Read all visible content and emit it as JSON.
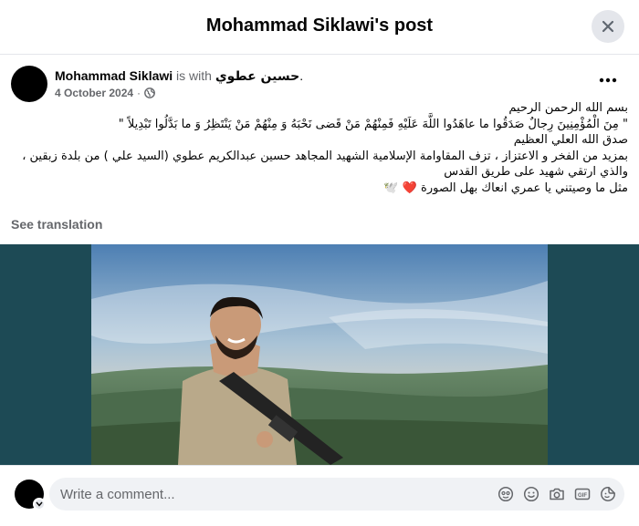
{
  "header": {
    "title": "Mohammad Siklawi's post"
  },
  "post": {
    "author": "Mohammad Siklawi",
    "is_with": "is with",
    "tagged": "حسين عطوي",
    "tagged_suffix": ".",
    "date": "4 October 2024",
    "dot": "·",
    "audience_icon": "globe-icon",
    "lines": [
      "بسم الله الرحمن الرحيم",
      "\" مِنَ الْمُؤْمِنِينَ رِجالٌ صَدَقُوا ما عاهَدُوا اللَّهَ عَلَيْهِ فَمِنْهُمْ مَنْ قَضى نَحْبَهُ وَ مِنْهُمْ مَنْ يَنْتَظِرُ وَ ما بَدَّلُوا تَبْدِيلاً \"",
      "صدق الله العلي العظيم",
      "بمزيد من الفخر و الاعتزاز ، تزف المقاوامة الإسلامية الشهيد المجاهد حسين عبدالكريم عطوي (السيد علي ) من بلدة زبقين ، والذي ارتقي شهيد على طريق القدس",
      "مثل ما وصيتني يا عمري انعاك بهل الصورة ❤️ 🕊️"
    ],
    "see_translation": "See translation"
  },
  "comment": {
    "placeholder": "Write a comment...",
    "icons": [
      "avatar-icon",
      "emoji-icon",
      "camera-icon",
      "gif-icon",
      "sticker-icon"
    ]
  },
  "colors": {
    "text_primary": "#050505",
    "text_secondary": "#65676b",
    "button_bg": "#e4e6eb",
    "input_bg": "#f0f2f5",
    "heart": "#e41e3f"
  }
}
